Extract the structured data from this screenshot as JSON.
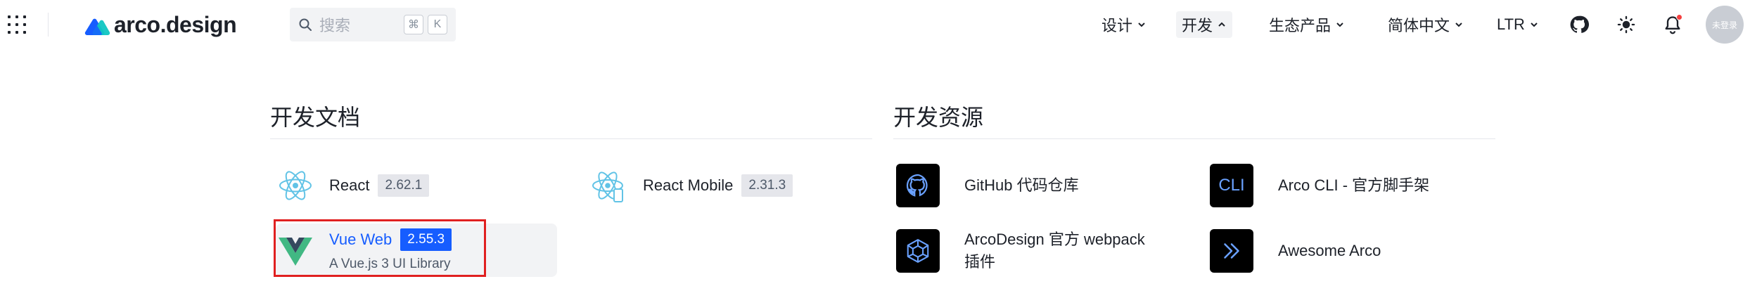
{
  "header": {
    "logo_text": "arco.design",
    "search": {
      "placeholder": "搜索",
      "key1": "⌘",
      "key2": "K"
    },
    "nav": [
      {
        "label": "设计",
        "active": false
      },
      {
        "label": "开发",
        "active": true
      },
      {
        "label": "生态产品",
        "active": false
      },
      {
        "label": "简体中文",
        "active": false
      },
      {
        "label": "LTR",
        "active": false
      }
    ],
    "icons": [
      "github-icon",
      "theme-sun-icon",
      "notification-bell-icon"
    ],
    "avatar_text": "未登录"
  },
  "panel": {
    "docs": {
      "title": "开发文档",
      "items": [
        {
          "name": "React",
          "version": "2.62.1",
          "icon": "react-icon"
        },
        {
          "name": "React Mobile",
          "version": "2.31.3",
          "icon": "react-mobile-icon"
        },
        {
          "name": "Vue Web",
          "version": "2.55.3",
          "description": "A Vue.js 3 UI Library",
          "icon": "vue-icon"
        }
      ]
    },
    "resources": {
      "title": "开发资源",
      "items": [
        {
          "name": "GitHub 代码仓库",
          "icon": "github-icon"
        },
        {
          "name": "Arco CLI - 官方脚手架",
          "icon_text": "CLI"
        },
        {
          "name_line1": "ArcoDesign 官方 webpack",
          "name_line2": "插件",
          "icon": "webpack-icon"
        },
        {
          "name": "Awesome Arco",
          "icon": "double-chevron-icon"
        }
      ]
    }
  },
  "colors": {
    "primary": "#165dff",
    "highlight_box": "#e02020",
    "icon_box": "#000000"
  }
}
